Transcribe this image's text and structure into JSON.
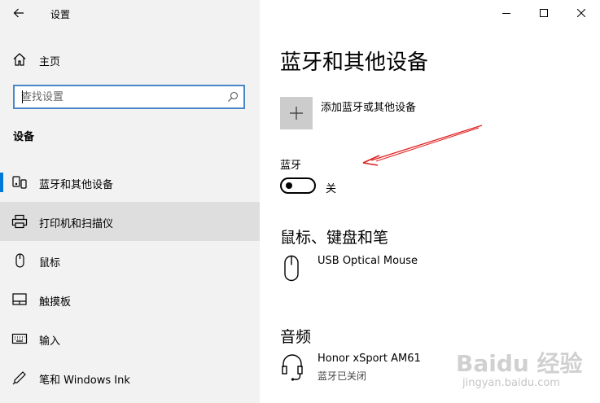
{
  "window": {
    "title": "设置",
    "controls": [
      "minimize-icon",
      "maximize-icon",
      "close-icon"
    ]
  },
  "nav": {
    "home": "主页",
    "search_placeholder": "查找设置",
    "section": "设备",
    "items": [
      {
        "label": "蓝牙和其他设备",
        "icon": "bluetooth-devices-icon",
        "selected": true
      },
      {
        "label": "打印机和扫描仪",
        "icon": "printer-icon",
        "hovered": true
      },
      {
        "label": "鼠标",
        "icon": "mouse-icon"
      },
      {
        "label": "触摸板",
        "icon": "touchpad-icon"
      },
      {
        "label": "输入",
        "icon": "keyboard-icon"
      },
      {
        "label": "笔和 Windows Ink",
        "icon": "pen-icon"
      }
    ]
  },
  "main": {
    "title": "蓝牙和其他设备",
    "add_device": "添加蓝牙或其他设备",
    "bluetooth": {
      "label": "蓝牙",
      "state": "关",
      "on": false
    },
    "mouse_section": {
      "title": "鼠标、键盘和笔",
      "devices": [
        {
          "name": "USB Optical Mouse",
          "icon": "mouse-icon"
        }
      ]
    },
    "audio_section": {
      "title": "音频",
      "devices": [
        {
          "name": "Honor xSport AM61",
          "status": "蓝牙已关闭",
          "icon": "headset-icon"
        }
      ]
    }
  },
  "colors": {
    "accent": "#0078d7",
    "nav_background": "#f2f2f2",
    "annotation_arrow": "#e02020"
  },
  "watermark": {
    "brand": "Baidu 经验",
    "url": "jingyan.baidu.com"
  }
}
